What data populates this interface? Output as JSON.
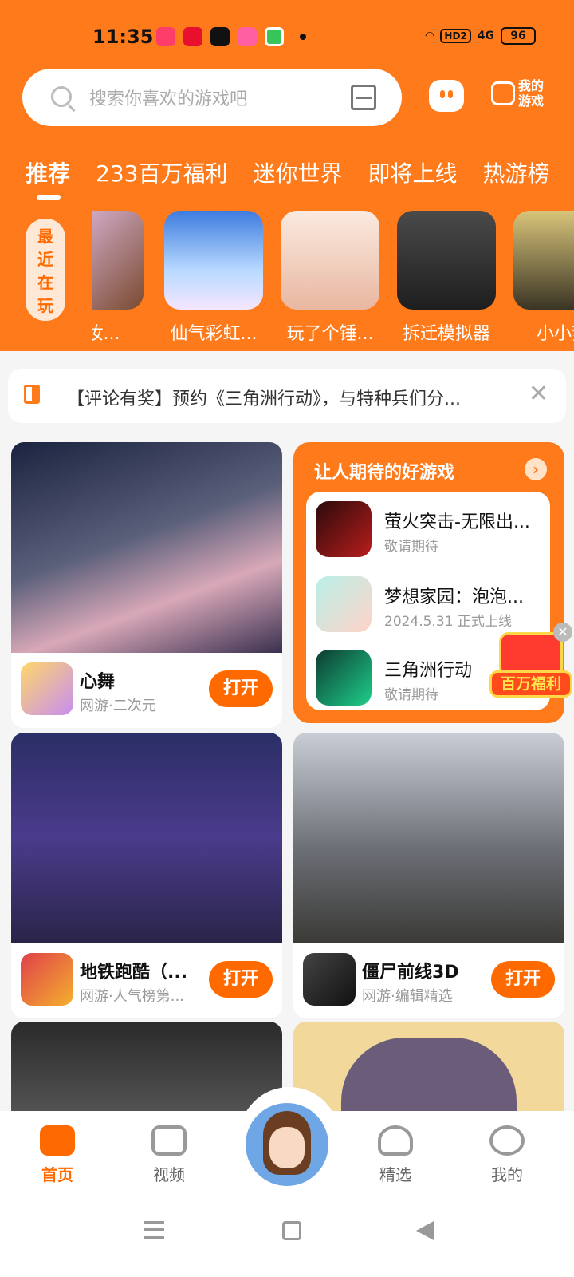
{
  "status_bar": {
    "time": "11:35",
    "network": "HD2",
    "signal": "4G",
    "battery": "96"
  },
  "search": {
    "placeholder": "搜索你喜欢的游戏吧"
  },
  "header": {
    "my_games": "我的游戏"
  },
  "tabs": [
    {
      "label": "推荐",
      "active": true
    },
    {
      "label": "233百万福利"
    },
    {
      "label": "迷你世界"
    },
    {
      "label": "即将上线"
    },
    {
      "label": "热游榜"
    }
  ],
  "recent": {
    "label": "最近在玩",
    "items": [
      {
        "name": "化妆..."
      },
      {
        "name": "仙气彩虹..."
      },
      {
        "name": "玩了个锤..."
      },
      {
        "name": "拆迁模拟器"
      },
      {
        "name": "小小梦"
      }
    ]
  },
  "notice": {
    "text": "【评论有奖】预约《三角洲行动》，与特种兵们分..."
  },
  "cards": [
    {
      "title": "心舞",
      "sub": "网游·二次元",
      "button": "打开"
    },
    {
      "title": "地铁跑酷（...",
      "sub": "网游·人气榜第...",
      "button": "打开"
    },
    {
      "title": "僵尸前线3D",
      "sub": "网游·编辑精选",
      "button": "打开"
    }
  ],
  "promo": {
    "title": "让人期待的好游戏",
    "items": [
      {
        "name": "萤火突击-无限出...",
        "status": "敬请期待"
      },
      {
        "name": "梦想家园：泡泡...",
        "status": "2024.5.31 正式上线"
      },
      {
        "name": "三角洲行动",
        "status": "敬请期待"
      }
    ]
  },
  "float_badge": {
    "label": "百万福利"
  },
  "bottom_nav": [
    {
      "label": "首页",
      "active": true
    },
    {
      "label": "视频"
    },
    {
      "label": "精选"
    },
    {
      "label": "我的"
    }
  ],
  "colors": {
    "brand": "#ff7a1a",
    "button": "#ff6a00"
  }
}
